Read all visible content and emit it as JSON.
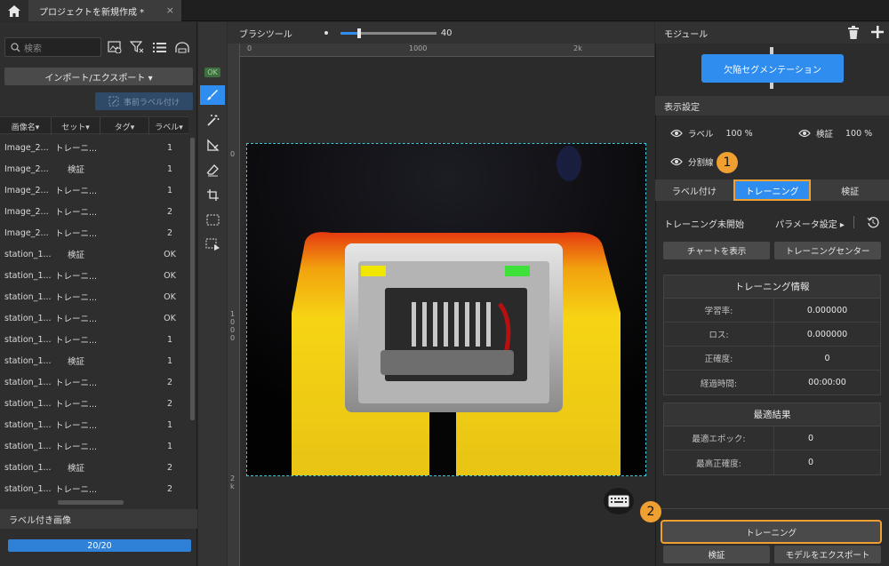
{
  "titlebar": {
    "tab_title": "プロジェクトを新規作成 *",
    "close_glyph": "×"
  },
  "left": {
    "search_placeholder": "検索",
    "import_export": "インポート/エクスポート ▾",
    "pre_label": "事前ラベル付け",
    "columns": [
      "画像名▾",
      "セット▾",
      "タグ▾",
      "ラベル▾"
    ],
    "rows": [
      {
        "name": "Image_2...",
        "set": "トレーニ...",
        "tag": "",
        "label": "1"
      },
      {
        "name": "Image_2...",
        "set": "検証",
        "tag": "",
        "label": "1"
      },
      {
        "name": "Image_2...",
        "set": "トレーニ...",
        "tag": "",
        "label": "1"
      },
      {
        "name": "Image_2...",
        "set": "トレーニ...",
        "tag": "",
        "label": "2"
      },
      {
        "name": "Image_2...",
        "set": "トレーニ...",
        "tag": "",
        "label": "2"
      },
      {
        "name": "station_1...",
        "set": "検証",
        "tag": "",
        "label": "OK"
      },
      {
        "name": "station_1...",
        "set": "トレーニ...",
        "tag": "",
        "label": "OK"
      },
      {
        "name": "station_1...",
        "set": "トレーニ...",
        "tag": "",
        "label": "OK"
      },
      {
        "name": "station_1...",
        "set": "トレーニ...",
        "tag": "",
        "label": "OK"
      },
      {
        "name": "station_1...",
        "set": "トレーニ...",
        "tag": "",
        "label": "1"
      },
      {
        "name": "station_1...",
        "set": "検証",
        "tag": "",
        "label": "1"
      },
      {
        "name": "station_1...",
        "set": "トレーニ...",
        "tag": "",
        "label": "2"
      },
      {
        "name": "station_1...",
        "set": "トレーニ...",
        "tag": "",
        "label": "2"
      },
      {
        "name": "station_1...",
        "set": "トレーニ...",
        "tag": "",
        "label": "1"
      },
      {
        "name": "station_1...",
        "set": "トレーニ...",
        "tag": "",
        "label": "1"
      },
      {
        "name": "station_1...",
        "set": "検証",
        "tag": "",
        "label": "2"
      },
      {
        "name": "station_1...",
        "set": "トレーニ...",
        "tag": "",
        "label": "2"
      }
    ],
    "labeled_images": "ラベル付き画像",
    "progress_text": "20/20",
    "progress_fraction": 1.0
  },
  "tools": {
    "ok_badge": "OK"
  },
  "canvas": {
    "brush_tool": "ブラシツール",
    "brush_size": "40",
    "brush_size_fraction": 0.2,
    "ruler_labels": [
      "0",
      "1000",
      "2k"
    ],
    "vruler_labels": [
      "0",
      "1\n0\n0\n0",
      "2\nk"
    ]
  },
  "right": {
    "module_title": "モジュール",
    "defect_button": "欠陥セグメンテーション",
    "display_settings": "表示設定",
    "label_opt": "ラベル",
    "label_pct": "100 %",
    "verify_opt": "検証",
    "verify_pct": "100 %",
    "split_opt": "分割線",
    "tabs": [
      "ラベル付け",
      "トレーニング",
      "検証"
    ],
    "training_status": "トレーニング未開始",
    "param_settings": "パラメータ設定 ▸",
    "show_chart": "チャートを表示",
    "training_center": "トレーニングセンター",
    "training_info": {
      "title": "トレーニング情報",
      "rows": [
        {
          "k": "学習率:",
          "v": "0.000000"
        },
        {
          "k": "ロス:",
          "v": "0.000000"
        },
        {
          "k": "正確度:",
          "v": "0"
        },
        {
          "k": "経過時間:",
          "v": "00:00:00"
        }
      ]
    },
    "best_result": {
      "title": "最適結果",
      "rows": [
        {
          "k": "最適エポック:",
          "v": "0"
        },
        {
          "k": "最高正確度:",
          "v": "0"
        }
      ]
    },
    "train_button": "トレーニング",
    "verify_button": "検証",
    "export_button": "モデルをエクスポート"
  },
  "markers": {
    "m1": "1",
    "m2": "2"
  },
  "colors": {
    "accent": "#2f8df0",
    "highlight": "#f0a030"
  }
}
